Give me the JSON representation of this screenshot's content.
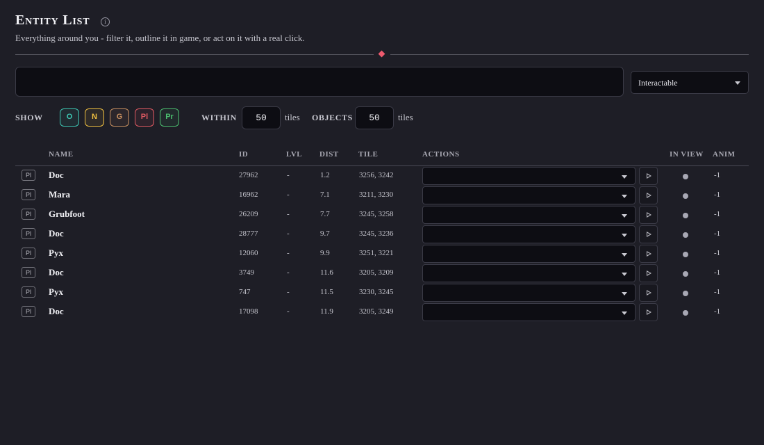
{
  "header": {
    "title": "Entity List",
    "subtitle": "Everything around you - filter it, outline it in game, or act on it with a real click.",
    "info_icon": "info-icon"
  },
  "search": {
    "value": "",
    "placeholder": ""
  },
  "filter": {
    "selected": "Interactable"
  },
  "show": {
    "label": "SHOW",
    "chips": [
      {
        "label": "O",
        "color": "#3ec8b4"
      },
      {
        "label": "N",
        "color": "#f0c040"
      },
      {
        "label": "G",
        "color": "#c89060"
      },
      {
        "label": "Pl",
        "color": "#e05a62"
      },
      {
        "label": "Pr",
        "color": "#4cc070"
      }
    ]
  },
  "within": {
    "label": "WITHIN",
    "value": "50",
    "unit": "tiles"
  },
  "objects": {
    "label": "OBJECTS",
    "value": "50",
    "unit": "tiles"
  },
  "table": {
    "columns": [
      "NAME",
      "ID",
      "LVL",
      "DIST",
      "TILE",
      "ACTIONS",
      "IN VIEW",
      "ANIM"
    ],
    "rows": [
      {
        "type": "Pl",
        "name": "Doc",
        "id": "27962",
        "lvl": "-",
        "dist": "1.2",
        "tile": "3256, 3242",
        "anim": "-1"
      },
      {
        "type": "Pl",
        "name": "Mara",
        "id": "16962",
        "lvl": "-",
        "dist": "7.1",
        "tile": "3211, 3230",
        "anim": "-1"
      },
      {
        "type": "Pl",
        "name": "Grubfoot",
        "id": "26209",
        "lvl": "-",
        "dist": "7.7",
        "tile": "3245, 3258",
        "anim": "-1"
      },
      {
        "type": "Pl",
        "name": "Doc",
        "id": "28777",
        "lvl": "-",
        "dist": "9.7",
        "tile": "3245, 3236",
        "anim": "-1"
      },
      {
        "type": "Pl",
        "name": "Pyx",
        "id": "12060",
        "lvl": "-",
        "dist": "9.9",
        "tile": "3251, 3221",
        "anim": "-1"
      },
      {
        "type": "Pl",
        "name": "Doc",
        "id": "3749",
        "lvl": "-",
        "dist": "11.6",
        "tile": "3205, 3209",
        "anim": "-1"
      },
      {
        "type": "Pl",
        "name": "Pyx",
        "id": "747",
        "lvl": "-",
        "dist": "11.5",
        "tile": "3230, 3245",
        "anim": "-1"
      },
      {
        "type": "Pl",
        "name": "Doc",
        "id": "17098",
        "lvl": "-",
        "dist": "11.9",
        "tile": "3205, 3249",
        "anim": "-1"
      }
    ]
  }
}
